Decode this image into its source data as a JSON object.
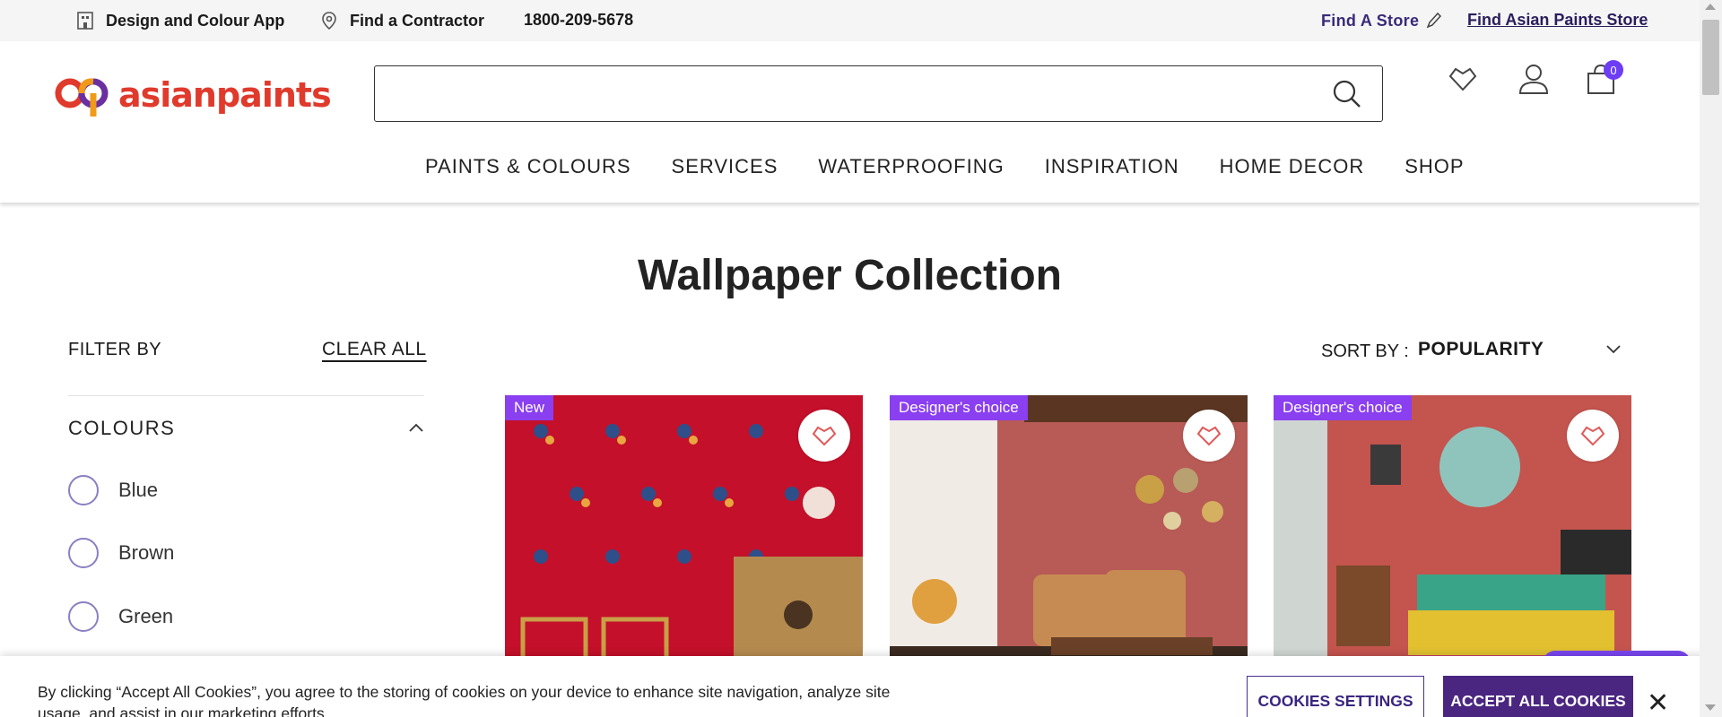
{
  "topbar": {
    "design_app": "Design and Colour App",
    "find_contractor": "Find a Contractor",
    "phone": "1800-209-5678",
    "find_store": "Find A Store",
    "find_ap_store": "Find Asian Paints Store"
  },
  "header": {
    "logo_text": "asianpaints",
    "search_placeholder": "",
    "cart_count": "0",
    "nav": [
      "PAINTS & COLOURS",
      "SERVICES",
      "WATERPROOFING",
      "INSPIRATION",
      "HOME DECOR",
      "SHOP"
    ]
  },
  "main": {
    "title": "Wallpaper Collection",
    "filter_by": "FILTER BY",
    "clear_all": "CLEAR ALL",
    "colours_header": "COLOURS",
    "colour_options": [
      "Blue",
      "Brown",
      "Green"
    ],
    "sort_label": "SORT BY :",
    "sort_value": "POPULARITY"
  },
  "products": [
    {
      "badge": "New"
    },
    {
      "badge": "Designer's choice"
    },
    {
      "badge": "Designer's choice"
    }
  ],
  "cookie": {
    "text": "By clicking “Accept All Cookies”, you agree to the storing of cookies on your device to enhance site navigation, analyze site usage, and assist in our marketing efforts.",
    "settings_label": "COOKIES SETTINGS",
    "accept_label": "ACCEPT ALL COOKIES",
    "close": "✕"
  },
  "colors": {
    "brand_red": "#e03a2c",
    "badge_purple": "#8a3ff0",
    "accept_purple": "#4a2680",
    "cart_badge": "#6c3df4"
  }
}
